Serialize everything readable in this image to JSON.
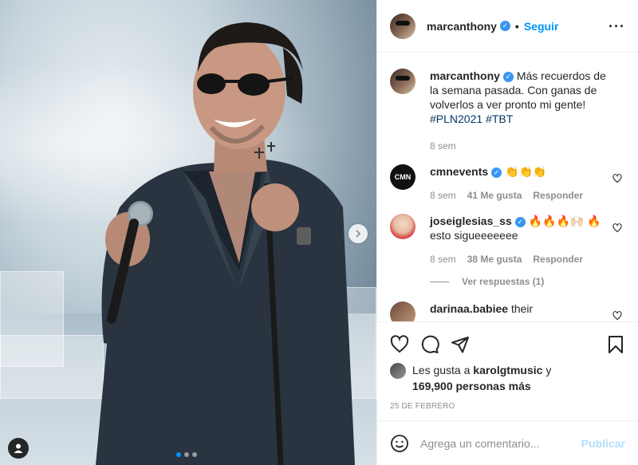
{
  "header": {
    "username": "marcanthony",
    "follow_label": "Seguir",
    "bullet": "•",
    "more": "···"
  },
  "caption": {
    "username": "marcanthony",
    "text": "Más recuerdos de la semana pasada. Con ganas de volverlos a ver pronto mi gente!",
    "hashtags": [
      "#PLN2021",
      "#TBT"
    ],
    "time": "8 sem"
  },
  "comments": [
    {
      "username": "cmnevents",
      "avatar_text": "CMN",
      "text": "👏👏👏",
      "time": "8 sem",
      "likes": "41 Me gusta",
      "reply_label": "Responder",
      "verified": true
    },
    {
      "username": "joseiglesias_ss",
      "text": "🔥🔥🔥🙌🏻 🔥 esto sigueeeeeee",
      "time": "8 sem",
      "likes": "38 Me gusta",
      "reply_label": "Responder",
      "verified": true
    },
    {
      "username": "darinaa.babiee",
      "text": "their",
      "verified": false
    }
  ],
  "view_replies_label": "Ver respuestas (1)",
  "likes_summary": {
    "prefix": "Les gusta a",
    "user": "karolgtmusic",
    "joiner": "y",
    "others": "169,900 personas más"
  },
  "post_date": "25 DE FEBRERO",
  "add_comment": {
    "placeholder": "Agrega un comentario...",
    "post_label": "Publicar"
  },
  "carousel": {
    "total": 3,
    "active_index": 0
  },
  "colors": {
    "link_blue": "#0095f6",
    "hashtag": "#00376b",
    "muted": "#8e8e8e",
    "verified": "#3897f0",
    "publish_disabled": "#b2dffc"
  }
}
